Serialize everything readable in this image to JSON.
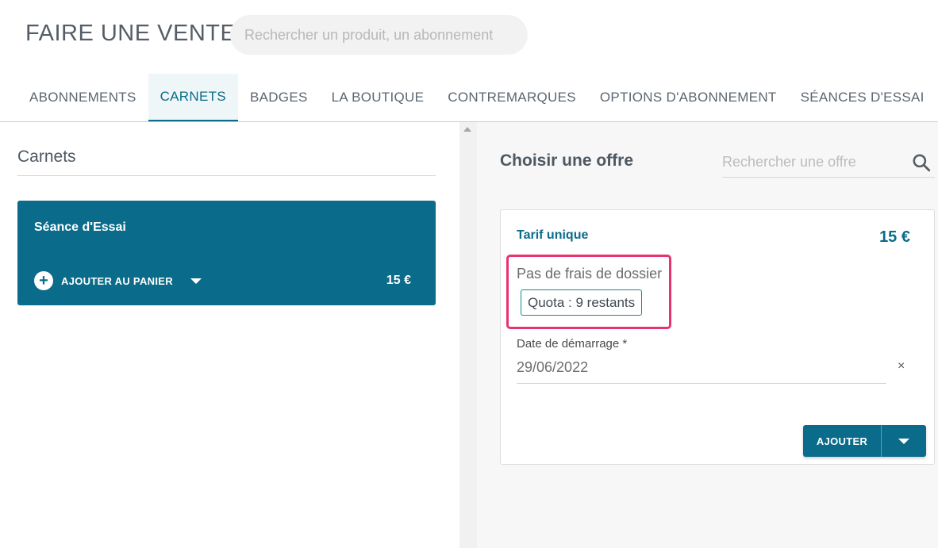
{
  "header": {
    "title": "FAIRE UNE VENTE",
    "search_placeholder": "Rechercher un produit, un abonnement"
  },
  "tabs": [
    {
      "label": "ABONNEMENTS",
      "active": false
    },
    {
      "label": "CARNETS",
      "active": true
    },
    {
      "label": "BADGES",
      "active": false
    },
    {
      "label": "LA BOUTIQUE",
      "active": false
    },
    {
      "label": "CONTREMARQUES",
      "active": false
    },
    {
      "label": "OPTIONS D'ABONNEMENT",
      "active": false
    },
    {
      "label": "SÉANCES D'ESSAI",
      "active": false
    }
  ],
  "left": {
    "title": "Carnets",
    "product": {
      "name": "Séance d'Essai",
      "add_label": "AJOUTER AU PANIER",
      "price": "15 €"
    }
  },
  "right": {
    "title": "Choisir une offre",
    "search_placeholder": "Rechercher une offre",
    "offer": {
      "name": "Tarif unique",
      "price": "15 €",
      "fees": "Pas de frais de dossier",
      "quota": "Quota : 9 restants",
      "date_label": "Date de démarrage *",
      "date_value": "29/06/2022",
      "clear": "×",
      "add_label": "AJOUTER"
    }
  },
  "colors": {
    "primary": "#0a6b8a",
    "highlight": "#e8336e",
    "quota_border": "#0f8a93"
  },
  "icons": {
    "search": "search-icon",
    "plus": "plus-circle-icon",
    "caret": "caret-down-icon",
    "scroll_up": "scroll-up-arrow-icon"
  }
}
